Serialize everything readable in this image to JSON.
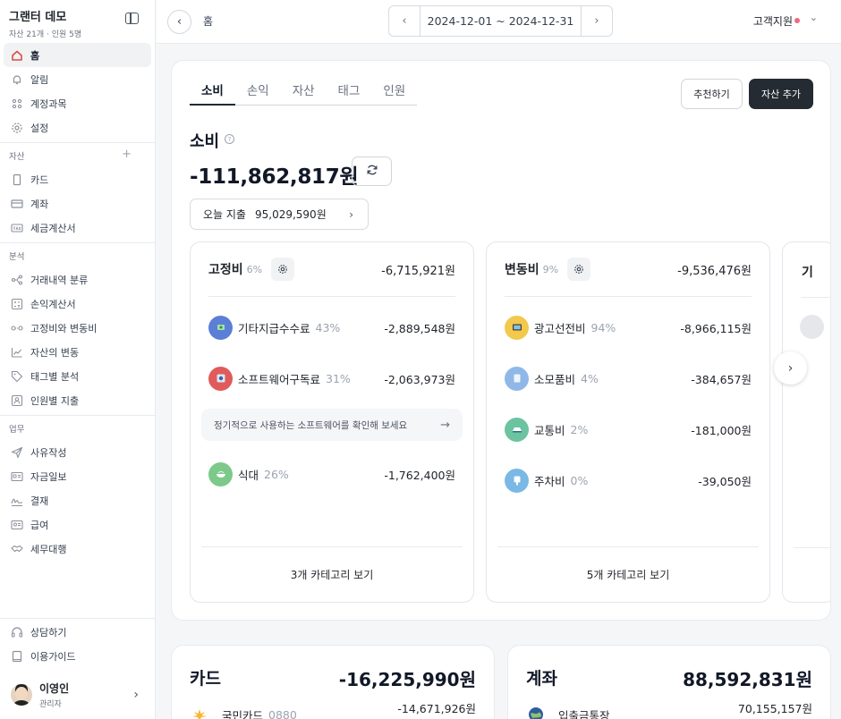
{
  "app": {
    "title": "그랜터 데모",
    "subtitle": "자산 21개 · 인원 5명"
  },
  "sidebar": {
    "top_items": [
      {
        "label": "홈",
        "icon": "home-icon"
      },
      {
        "label": "알림",
        "icon": "bell-icon"
      },
      {
        "label": "계정과목",
        "icon": "account-tree-icon"
      },
      {
        "label": "설정",
        "icon": "gear-icon"
      }
    ],
    "assets_section": "자산",
    "asset_items": [
      {
        "label": "카드",
        "icon": "card-icon"
      },
      {
        "label": "계좌",
        "icon": "bank-account-icon"
      },
      {
        "label": "세금계산서",
        "icon": "tax-invoice-icon"
      }
    ],
    "analysis_section": "분석",
    "analysis_items": [
      {
        "label": "거래내역 분류",
        "icon": "classify-icon"
      },
      {
        "label": "손익계산서",
        "icon": "income-statement-icon"
      },
      {
        "label": "고정비와 변동비",
        "icon": "fixed-variable-icon"
      },
      {
        "label": "자산의 변동",
        "icon": "trend-icon"
      },
      {
        "label": "태그별 분석",
        "icon": "tag-icon"
      },
      {
        "label": "인원별 지출",
        "icon": "person-icon"
      }
    ],
    "work_section": "업무",
    "work_items": [
      {
        "label": "사유작성",
        "icon": "send-icon"
      },
      {
        "label": "자금일보",
        "icon": "daily-report-icon"
      },
      {
        "label": "결재",
        "icon": "signature-icon"
      },
      {
        "label": "급여",
        "icon": "payroll-icon"
      },
      {
        "label": "세무대행",
        "icon": "handshake-icon"
      }
    ],
    "bottom_items": [
      {
        "label": "상담하기",
        "icon": "headset-icon"
      },
      {
        "label": "이용가이드",
        "icon": "guide-book-icon"
      }
    ],
    "profile": {
      "name": "이영인",
      "role": "관리자"
    }
  },
  "topbar": {
    "breadcrumb": "홈",
    "date_range": "2024-12-01 ~ 2024-12-31",
    "support_label": "고객지원"
  },
  "main": {
    "tabs": [
      "소비",
      "손익",
      "자산",
      "태그",
      "인원"
    ],
    "active_tab": "소비",
    "recommend_label": "추천하기",
    "add_asset_label": "자산 추가",
    "section_title": "소비",
    "total": "-111,862,817원",
    "today_label": "오늘 지출",
    "today_value": "95,029,590원",
    "categories": [
      {
        "name": "고정비",
        "pct": "6%",
        "amount": "-6,715,921원",
        "rows": [
          {
            "name": "기타지급수수료",
            "pct": "43%",
            "amount": "-2,889,548원",
            "icon": "fee-icon",
            "color": "#5b7fd6"
          },
          {
            "name": "소프트웨어구독료",
            "pct": "31%",
            "amount": "-2,063,973원",
            "icon": "software-icon",
            "color": "#e05b5b"
          },
          {
            "name": "식대",
            "pct": "26%",
            "amount": "-1,762,400원",
            "icon": "meal-icon",
            "color": "#7cc98a"
          }
        ],
        "tip": "정기적으로 사용하는 소프트웨어를 확인해 보세요",
        "footer": "3개 카테고리 보기"
      },
      {
        "name": "변동비",
        "pct": "9%",
        "amount": "-9,536,476원",
        "rows": [
          {
            "name": "광고선전비",
            "pct": "94%",
            "amount": "-8,966,115원",
            "icon": "tv-icon",
            "color": "#f2c94c"
          },
          {
            "name": "소모품비",
            "pct": "4%",
            "amount": "-384,657원",
            "icon": "supplies-icon",
            "color": "#8fb8e8"
          },
          {
            "name": "교통비",
            "pct": "2%",
            "amount": "-181,000원",
            "icon": "transport-icon",
            "color": "#6cc3a0"
          },
          {
            "name": "주차비",
            "pct": "0%",
            "amount": "-39,050원",
            "icon": "parking-icon",
            "color": "#7ab8e6"
          }
        ],
        "footer": "5개 카테고리 보기"
      },
      {
        "name": "기"
      }
    ]
  },
  "cards_section": {
    "title": "카드",
    "amount": "-16,225,990원",
    "row_name": "국민카드",
    "row_sub": "0880",
    "row_amount": "-14,671,926원"
  },
  "accounts_section": {
    "title": "계좌",
    "amount": "88,592,831원",
    "row_name": "입출금통장",
    "row_amount": "70,155,157원"
  }
}
